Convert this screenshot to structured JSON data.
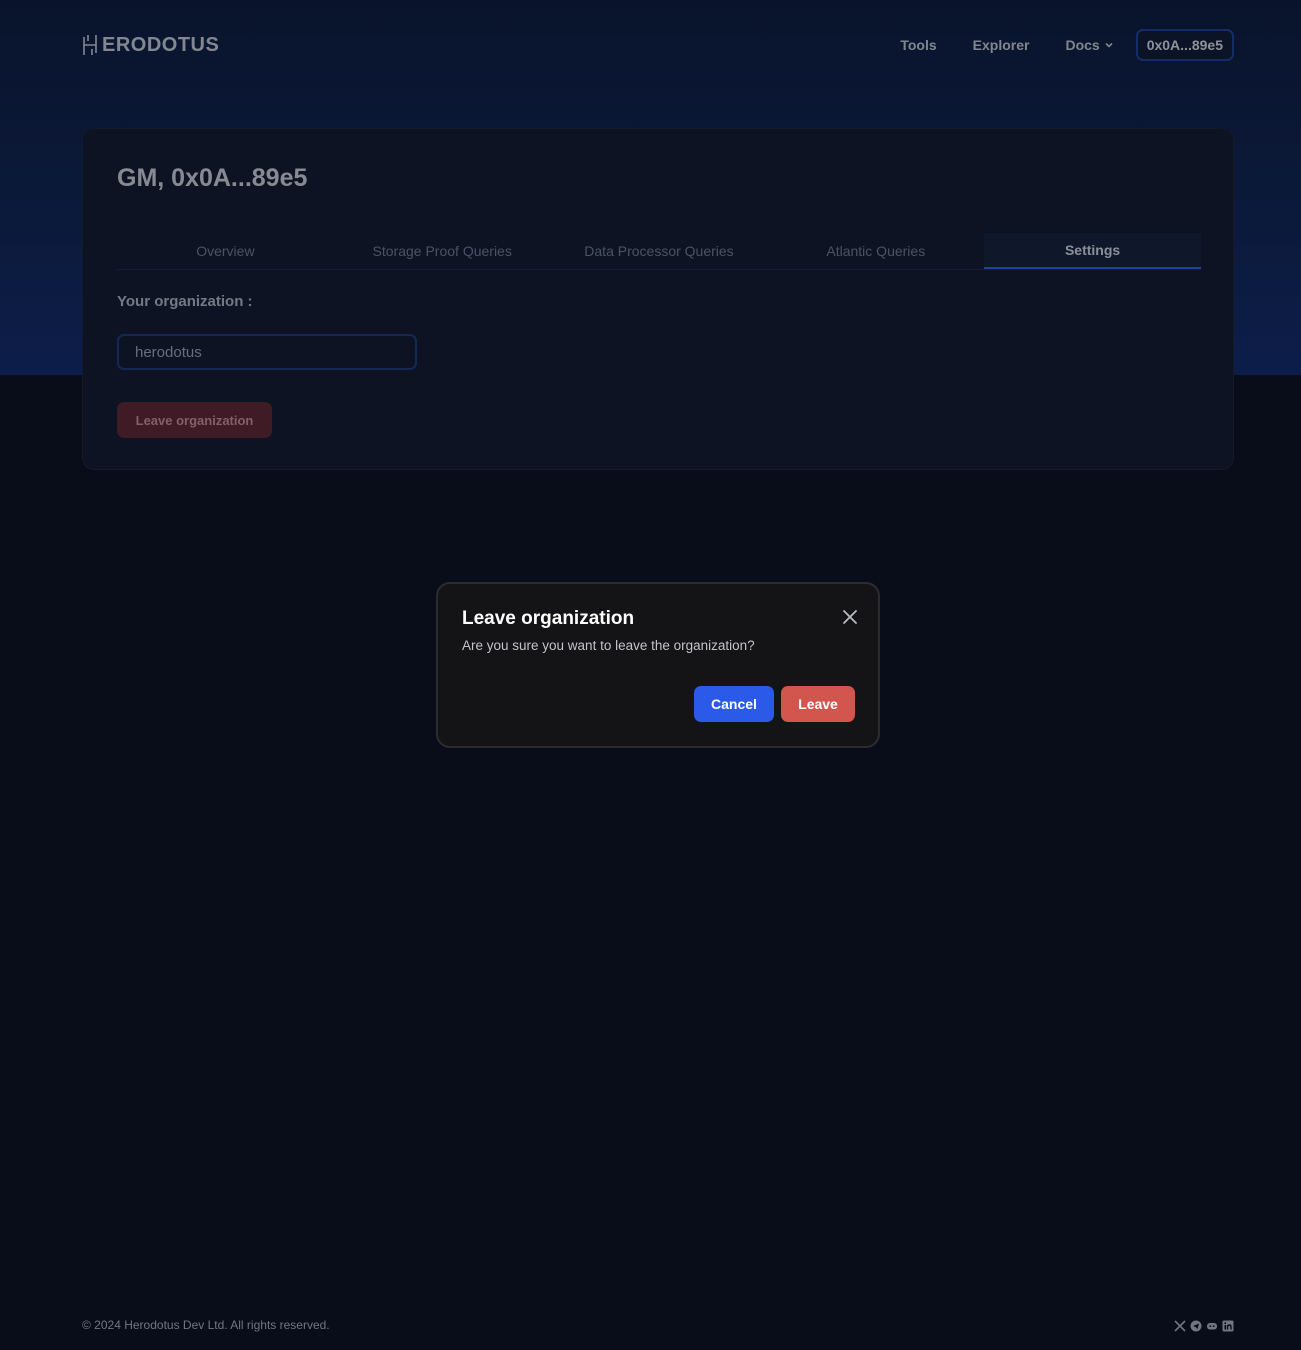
{
  "header": {
    "logo_text": "ERODOTUS",
    "logo_icon": "herodotus-h-icon",
    "nav": [
      {
        "label": "Tools"
      },
      {
        "label": "Explorer"
      },
      {
        "label": "Docs",
        "icon": "chevron-down-icon"
      }
    ],
    "wallet_label": "0x0A...89e5"
  },
  "dashboard": {
    "greeting": "GM, 0x0A...89e5",
    "tabs": [
      {
        "label": "Overview"
      },
      {
        "label": "Storage Proof Queries"
      },
      {
        "label": "Data Processor Queries"
      },
      {
        "label": "Atlantic Queries"
      },
      {
        "label": "Settings",
        "active": true
      }
    ],
    "org_label": "Your organization :",
    "org_value": "herodotus",
    "leave_org_label": "Leave organization"
  },
  "modal": {
    "title": "Leave organization",
    "body": "Are you sure you want to leave the organization?",
    "cancel_label": "Cancel",
    "leave_label": "Leave",
    "close_icon": "close-icon"
  },
  "footer": {
    "copyright": "© 2024 Herodotus Dev Ltd. All rights reserved.",
    "socials": [
      "x-icon",
      "telegram-icon",
      "discord-icon",
      "linkedin-icon"
    ]
  },
  "colors": {
    "accent": "#2c5ae8",
    "danger": "#d2564e",
    "background": "#0b101f"
  }
}
